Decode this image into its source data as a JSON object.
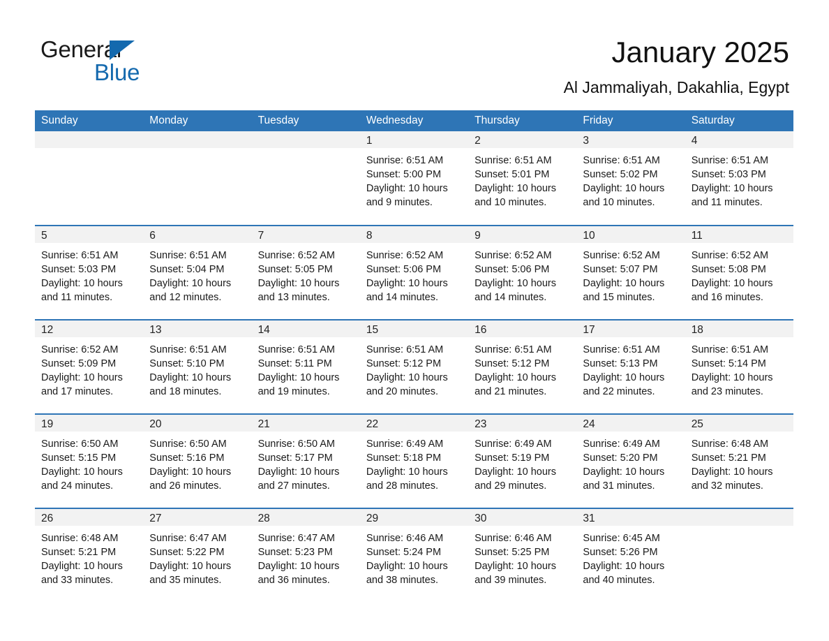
{
  "brand": {
    "line1": "General",
    "line2": "Blue",
    "triangle_color": "#1469ae",
    "icon": "triangle-flag-icon"
  },
  "header": {
    "title": "January 2025",
    "subtitle": "Al Jammaliyah, Dakahlia, Egypt"
  },
  "colors": {
    "header_blue": "#2e75b6",
    "daynum_gray": "#f2f2f2",
    "text": "#1a1a1a"
  },
  "weekdays": [
    "Sunday",
    "Monday",
    "Tuesday",
    "Wednesday",
    "Thursday",
    "Friday",
    "Saturday"
  ],
  "weeks": [
    [
      {
        "day": "",
        "lines": []
      },
      {
        "day": "",
        "lines": []
      },
      {
        "day": "",
        "lines": []
      },
      {
        "day": "1",
        "lines": [
          "Sunrise: 6:51 AM",
          "Sunset: 5:00 PM",
          "Daylight: 10 hours",
          "and 9 minutes."
        ]
      },
      {
        "day": "2",
        "lines": [
          "Sunrise: 6:51 AM",
          "Sunset: 5:01 PM",
          "Daylight: 10 hours",
          "and 10 minutes."
        ]
      },
      {
        "day": "3",
        "lines": [
          "Sunrise: 6:51 AM",
          "Sunset: 5:02 PM",
          "Daylight: 10 hours",
          "and 10 minutes."
        ]
      },
      {
        "day": "4",
        "lines": [
          "Sunrise: 6:51 AM",
          "Sunset: 5:03 PM",
          "Daylight: 10 hours",
          "and 11 minutes."
        ]
      }
    ],
    [
      {
        "day": "5",
        "lines": [
          "Sunrise: 6:51 AM",
          "Sunset: 5:03 PM",
          "Daylight: 10 hours",
          "and 11 minutes."
        ]
      },
      {
        "day": "6",
        "lines": [
          "Sunrise: 6:51 AM",
          "Sunset: 5:04 PM",
          "Daylight: 10 hours",
          "and 12 minutes."
        ]
      },
      {
        "day": "7",
        "lines": [
          "Sunrise: 6:52 AM",
          "Sunset: 5:05 PM",
          "Daylight: 10 hours",
          "and 13 minutes."
        ]
      },
      {
        "day": "8",
        "lines": [
          "Sunrise: 6:52 AM",
          "Sunset: 5:06 PM",
          "Daylight: 10 hours",
          "and 14 minutes."
        ]
      },
      {
        "day": "9",
        "lines": [
          "Sunrise: 6:52 AM",
          "Sunset: 5:06 PM",
          "Daylight: 10 hours",
          "and 14 minutes."
        ]
      },
      {
        "day": "10",
        "lines": [
          "Sunrise: 6:52 AM",
          "Sunset: 5:07 PM",
          "Daylight: 10 hours",
          "and 15 minutes."
        ]
      },
      {
        "day": "11",
        "lines": [
          "Sunrise: 6:52 AM",
          "Sunset: 5:08 PM",
          "Daylight: 10 hours",
          "and 16 minutes."
        ]
      }
    ],
    [
      {
        "day": "12",
        "lines": [
          "Sunrise: 6:52 AM",
          "Sunset: 5:09 PM",
          "Daylight: 10 hours",
          "and 17 minutes."
        ]
      },
      {
        "day": "13",
        "lines": [
          "Sunrise: 6:51 AM",
          "Sunset: 5:10 PM",
          "Daylight: 10 hours",
          "and 18 minutes."
        ]
      },
      {
        "day": "14",
        "lines": [
          "Sunrise: 6:51 AM",
          "Sunset: 5:11 PM",
          "Daylight: 10 hours",
          "and 19 minutes."
        ]
      },
      {
        "day": "15",
        "lines": [
          "Sunrise: 6:51 AM",
          "Sunset: 5:12 PM",
          "Daylight: 10 hours",
          "and 20 minutes."
        ]
      },
      {
        "day": "16",
        "lines": [
          "Sunrise: 6:51 AM",
          "Sunset: 5:12 PM",
          "Daylight: 10 hours",
          "and 21 minutes."
        ]
      },
      {
        "day": "17",
        "lines": [
          "Sunrise: 6:51 AM",
          "Sunset: 5:13 PM",
          "Daylight: 10 hours",
          "and 22 minutes."
        ]
      },
      {
        "day": "18",
        "lines": [
          "Sunrise: 6:51 AM",
          "Sunset: 5:14 PM",
          "Daylight: 10 hours",
          "and 23 minutes."
        ]
      }
    ],
    [
      {
        "day": "19",
        "lines": [
          "Sunrise: 6:50 AM",
          "Sunset: 5:15 PM",
          "Daylight: 10 hours",
          "and 24 minutes."
        ]
      },
      {
        "day": "20",
        "lines": [
          "Sunrise: 6:50 AM",
          "Sunset: 5:16 PM",
          "Daylight: 10 hours",
          "and 26 minutes."
        ]
      },
      {
        "day": "21",
        "lines": [
          "Sunrise: 6:50 AM",
          "Sunset: 5:17 PM",
          "Daylight: 10 hours",
          "and 27 minutes."
        ]
      },
      {
        "day": "22",
        "lines": [
          "Sunrise: 6:49 AM",
          "Sunset: 5:18 PM",
          "Daylight: 10 hours",
          "and 28 minutes."
        ]
      },
      {
        "day": "23",
        "lines": [
          "Sunrise: 6:49 AM",
          "Sunset: 5:19 PM",
          "Daylight: 10 hours",
          "and 29 minutes."
        ]
      },
      {
        "day": "24",
        "lines": [
          "Sunrise: 6:49 AM",
          "Sunset: 5:20 PM",
          "Daylight: 10 hours",
          "and 31 minutes."
        ]
      },
      {
        "day": "25",
        "lines": [
          "Sunrise: 6:48 AM",
          "Sunset: 5:21 PM",
          "Daylight: 10 hours",
          "and 32 minutes."
        ]
      }
    ],
    [
      {
        "day": "26",
        "lines": [
          "Sunrise: 6:48 AM",
          "Sunset: 5:21 PM",
          "Daylight: 10 hours",
          "and 33 minutes."
        ]
      },
      {
        "day": "27",
        "lines": [
          "Sunrise: 6:47 AM",
          "Sunset: 5:22 PM",
          "Daylight: 10 hours",
          "and 35 minutes."
        ]
      },
      {
        "day": "28",
        "lines": [
          "Sunrise: 6:47 AM",
          "Sunset: 5:23 PM",
          "Daylight: 10 hours",
          "and 36 minutes."
        ]
      },
      {
        "day": "29",
        "lines": [
          "Sunrise: 6:46 AM",
          "Sunset: 5:24 PM",
          "Daylight: 10 hours",
          "and 38 minutes."
        ]
      },
      {
        "day": "30",
        "lines": [
          "Sunrise: 6:46 AM",
          "Sunset: 5:25 PM",
          "Daylight: 10 hours",
          "and 39 minutes."
        ]
      },
      {
        "day": "31",
        "lines": [
          "Sunrise: 6:45 AM",
          "Sunset: 5:26 PM",
          "Daylight: 10 hours",
          "and 40 minutes."
        ]
      },
      {
        "day": "",
        "lines": []
      }
    ]
  ]
}
